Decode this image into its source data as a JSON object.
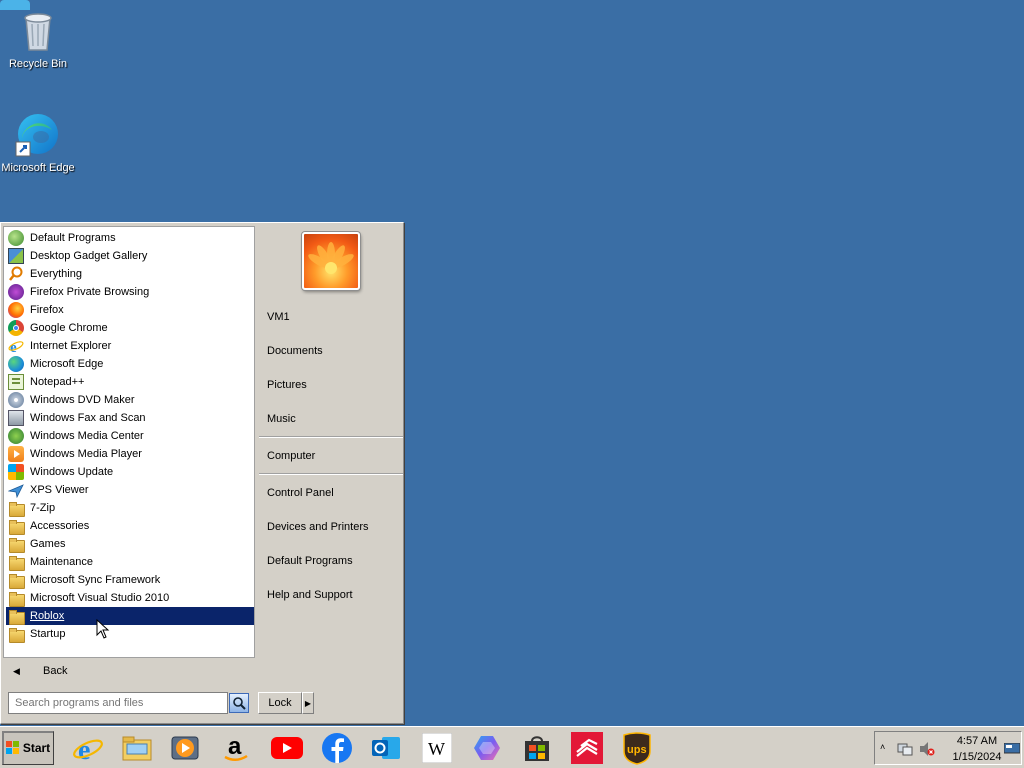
{
  "desktop": {
    "icons": [
      {
        "label": "Recycle Bin"
      },
      {
        "label": "Microsoft Edge"
      }
    ]
  },
  "start_menu": {
    "programs": [
      {
        "label": "Default Programs",
        "icon": "default-programs-icon"
      },
      {
        "label": "Desktop Gadget Gallery",
        "icon": "gadget-gallery-icon"
      },
      {
        "label": "Everything",
        "icon": "everything-search-icon"
      },
      {
        "label": "Firefox Private Browsing",
        "icon": "firefox-private-icon"
      },
      {
        "label": "Firefox",
        "icon": "firefox-icon"
      },
      {
        "label": "Google Chrome",
        "icon": "chrome-icon"
      },
      {
        "label": "Internet Explorer",
        "icon": "ie-icon"
      },
      {
        "label": "Microsoft Edge",
        "icon": "edge-icon"
      },
      {
        "label": "Notepad++",
        "icon": "notepadpp-icon"
      },
      {
        "label": "Windows DVD Maker",
        "icon": "dvd-maker-icon"
      },
      {
        "label": "Windows Fax and Scan",
        "icon": "fax-scan-icon"
      },
      {
        "label": "Windows Media Center",
        "icon": "media-center-icon"
      },
      {
        "label": "Windows Media Player",
        "icon": "media-player-icon"
      },
      {
        "label": "Windows Update",
        "icon": "windows-update-icon"
      },
      {
        "label": "XPS Viewer",
        "icon": "xps-viewer-icon"
      },
      {
        "label": "7-Zip",
        "icon": "folder-icon"
      },
      {
        "label": "Accessories",
        "icon": "folder-icon"
      },
      {
        "label": "Games",
        "icon": "folder-icon"
      },
      {
        "label": "Maintenance",
        "icon": "folder-icon"
      },
      {
        "label": "Microsoft Sync Framework",
        "icon": "folder-icon"
      },
      {
        "label": "Microsoft Visual Studio 2010",
        "icon": "folder-icon"
      },
      {
        "label": "Roblox",
        "icon": "folder-icon",
        "selected": true
      },
      {
        "label": "Startup",
        "icon": "folder-icon"
      }
    ],
    "back_label": "Back",
    "search_placeholder": "Search programs and files",
    "right_items": [
      {
        "label": "VM1"
      },
      {
        "label": "Documents"
      },
      {
        "label": "Pictures"
      },
      {
        "label": "Music"
      },
      {
        "label": "Computer"
      },
      {
        "label": "Control Panel"
      },
      {
        "label": "Devices and Printers"
      },
      {
        "label": "Default Programs"
      },
      {
        "label": "Help and Support"
      }
    ],
    "lock_label": "Lock"
  },
  "taskbar": {
    "start_label": "Start",
    "pinned": [
      "internet-explorer-icon",
      "file-explorer-icon",
      "media-player-icon",
      "amazon-icon",
      "youtube-icon",
      "facebook-icon",
      "outlook-icon",
      "wikipedia-icon",
      "copilot-icon",
      "store-icon",
      "bank-of-america-icon",
      "ups-icon"
    ],
    "clock": {
      "time": "4:57 AM",
      "date": "1/15/2024"
    }
  },
  "colors": {
    "desktop": "#3a6ea5",
    "selection": "#0a246a",
    "chrome": "#d4d0c8"
  }
}
